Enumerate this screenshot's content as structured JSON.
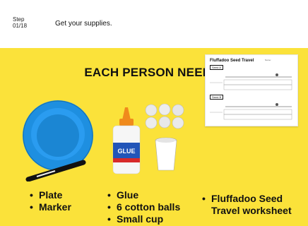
{
  "header": {
    "step_label": "Step",
    "step_number": "01/18",
    "instruction": "Get your supplies."
  },
  "panel": {
    "title": "EACH PERSON NEEDS:",
    "col1_items": [
      "Plate",
      "Marker"
    ],
    "col2_items": [
      "Glue",
      "6 cotton balls",
      "Small cup"
    ],
    "col3_items": [
      "Fluffadoo Seed Travel worksheet"
    ],
    "glue_label": "GLUE",
    "worksheet": {
      "title": "Fluffadoo Seed Travel",
      "name_label": "Name:",
      "seed_a": "Seed A",
      "seed_b": "Seed B"
    }
  },
  "colors": {
    "background_panel": "#fbe23a",
    "plate": "#1e8fe0",
    "glue_cap": "#f08a1c"
  }
}
